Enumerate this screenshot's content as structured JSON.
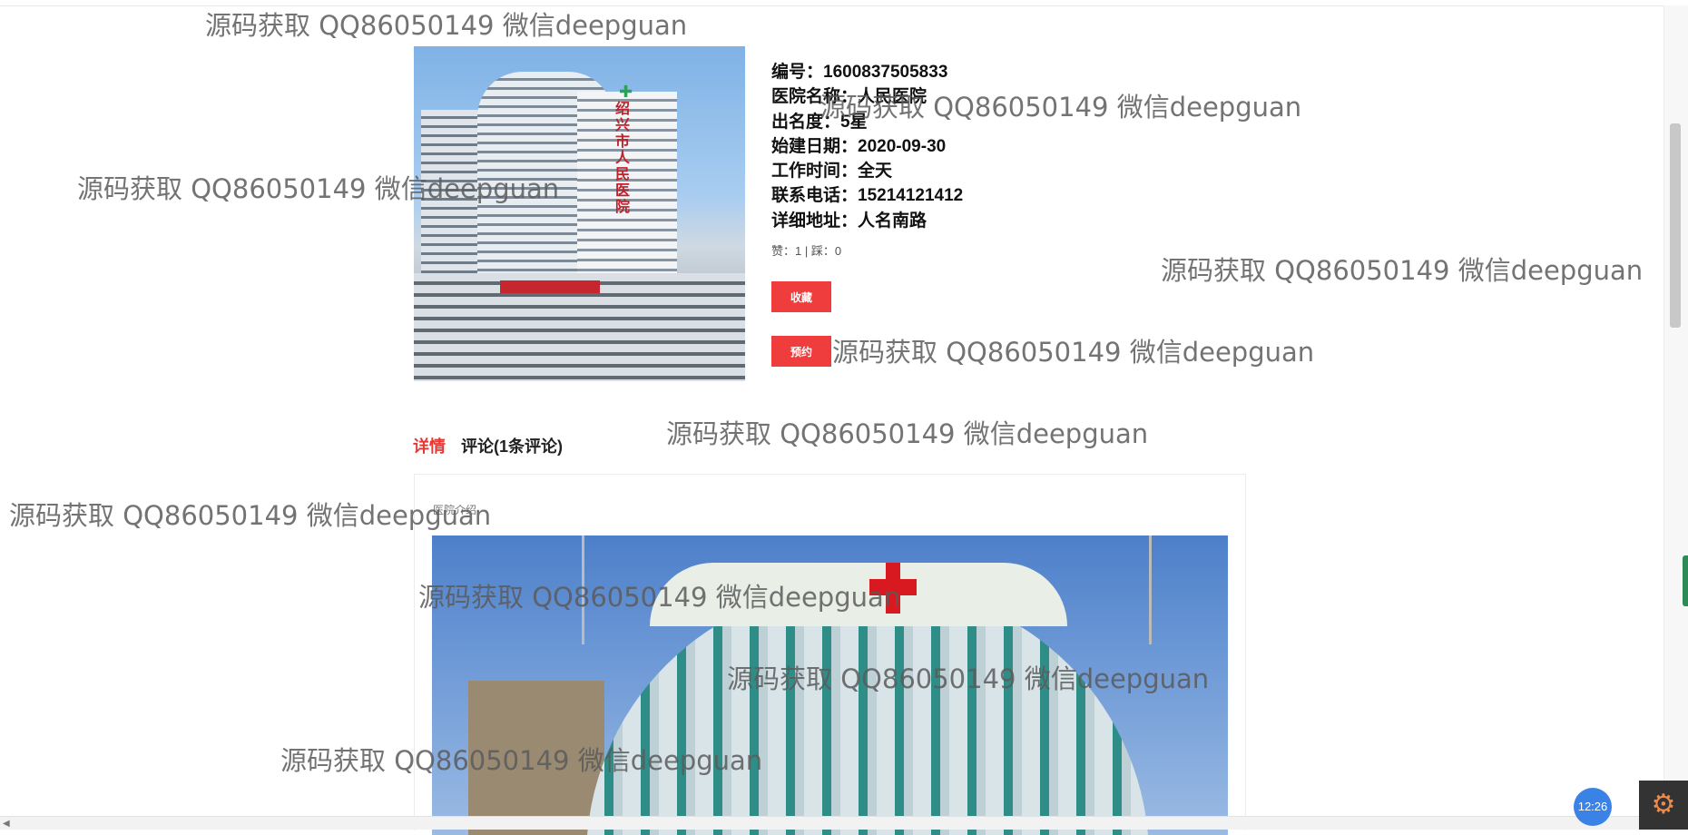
{
  "hospital": {
    "fields": [
      {
        "label": "编号：",
        "value": "1600837505833"
      },
      {
        "label": "医院名称：",
        "value": "人民医院"
      },
      {
        "label": "出名度：",
        "value": "5星"
      },
      {
        "label": "始建日期：",
        "value": "2020-09-30"
      },
      {
        "label": "工作时间：",
        "value": "全天"
      },
      {
        "label": "联系电话：",
        "value": "15214121412"
      },
      {
        "label": "详细地址：",
        "value": "人名南路"
      }
    ],
    "photo_sign_text": "绍兴市人民医院",
    "votes": "赞：1 | 踩：0"
  },
  "actions": {
    "favorite_label": "收藏",
    "book_label": "预约"
  },
  "tabs": [
    {
      "label": "详情",
      "active": true
    },
    {
      "label": "评论(1条评论)",
      "active": false
    }
  ],
  "detail": {
    "caption": "医院介绍"
  },
  "watermark_text": "源码获取 QQ86050149 微信deepguan",
  "taskbar": {
    "clock": "12:26"
  },
  "colors": {
    "accent": "#ef3d3d",
    "active_tab": "#e53935",
    "clock_bg": "#3b82e6"
  }
}
